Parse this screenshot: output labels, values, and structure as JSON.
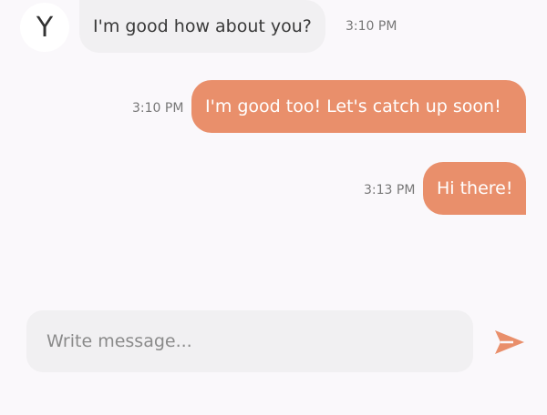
{
  "contact": {
    "avatar_letter": "Y"
  },
  "messages": [
    {
      "direction": "incoming",
      "text": "I'm good how about you?",
      "time": "3:10 PM"
    },
    {
      "direction": "outgoing",
      "text": "I'm good too! Let's catch up soon!",
      "time": "3:10 PM"
    },
    {
      "direction": "outgoing",
      "text": "Hi there!",
      "time": "3:13 PM"
    }
  ],
  "composer": {
    "placeholder": "Write message...",
    "value": ""
  },
  "icons": {
    "send": "send-icon"
  },
  "colors": {
    "outgoing_bubble": "#e98f6b",
    "incoming_bubble": "#f1f0f2",
    "background": "#faf8fb",
    "accent": "#e98f6b"
  }
}
